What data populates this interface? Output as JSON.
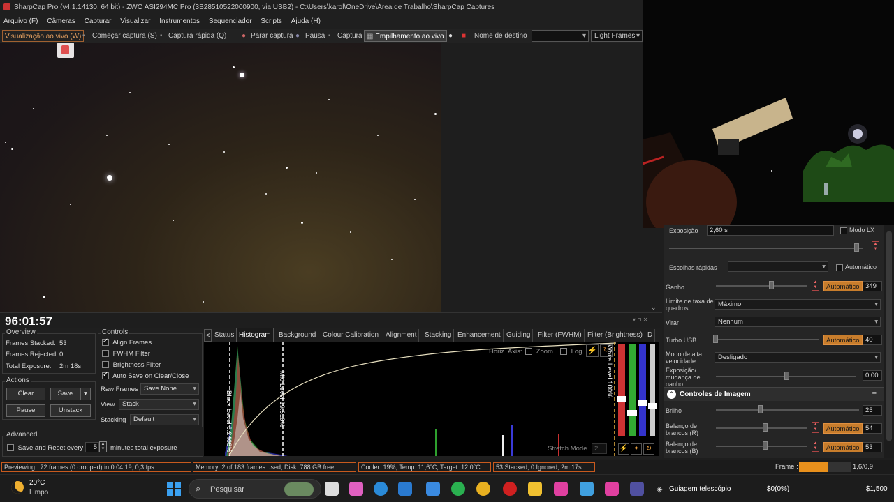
{
  "window": {
    "title": "SharpCap Pro (v4.1.14130, 64 bit) - ZWO ASI294MC Pro (3B28510522000900, via USB2) - C:\\Users\\karol\\OneDrive\\Área de Trabalho\\SharpCap Captures"
  },
  "menu": [
    "Arquivo (F)",
    "Câmeras",
    "Capturar",
    "Visualizar",
    "Instrumentos",
    "Sequenciador",
    "Scripts",
    "Ajuda (H)"
  ],
  "toolbar": {
    "live_view": "Visualização ao vivo (W)",
    "start_capture": "Começar captura (S)",
    "quick_capture": "Captura rápida (Q)",
    "stop_capture": "Parar captura",
    "pause": "Pausa",
    "capture": "Captura",
    "live_stack": "Empilhamento ao vivo",
    "target_label": "Nome de destino",
    "target_value": "",
    "frame_type": "Light Frames"
  },
  "camera_controls": {
    "exposure_label": "Exposição",
    "exposure_value": "2,60 s",
    "lx_mode": "Modo LX",
    "quick_picks_label": "Escolhas rápidas",
    "quick_picks_value": "",
    "auto": "Automático",
    "gain_label": "Ganho",
    "gain_auto": "Automático",
    "gain_value": "349",
    "frame_rate_label": "Limite de taxa de quadros",
    "frame_rate_value": "Máximo",
    "flip_label": "Virar",
    "flip_value": "Nenhum",
    "usb_label": "Turbo USB",
    "usb_auto": "Automático",
    "usb_value": "40",
    "hs_label": "Modo de alta velocidade",
    "hs_value": "Desligado",
    "exp_gain_label": "Exposição/ mudança de ganho",
    "exp_gain_value": "0.00",
    "image_controls_title": "Controles de Imagem",
    "brightness_label": "Brilho",
    "brightness_value": "25",
    "wb_r_label": "Balanço de brancos (R)",
    "wb_r_auto": "Automático",
    "wb_r_value": "54",
    "wb_b_label": "Balanço de brancos (B)",
    "wb_b_auto": "Automático",
    "wb_b_value": "53"
  },
  "stacking": {
    "timer": "96:01:57",
    "overview_title": "Overview",
    "frames_stacked_label": "Frames Stacked:",
    "frames_stacked": "53",
    "frames_rejected_label": "Frames Rejected:",
    "frames_rejected": "0",
    "total_exposure_label": "Total Exposure:",
    "total_exposure": "2m 18s",
    "actions_title": "Actions",
    "clear": "Clear",
    "save": "Save",
    "pause": "Pause",
    "unstack": "Unstack",
    "advanced_title": "Advanced",
    "save_reset_label": "Save and Reset every",
    "save_reset_value": "5",
    "minutes_label": "minutes total exposure",
    "controls_title": "Controls",
    "align_frames": "Align Frames",
    "fwhm_filter": "FWHM Filter",
    "brightness_filter": "Brightness Filter",
    "auto_save": "Auto Save on Clear/Close",
    "raw_frames_label": "Raw Frames",
    "raw_frames_value": "Save None",
    "view_label": "View",
    "view_value": "Stack",
    "stacking_label": "Stacking",
    "stacking_value": "Default"
  },
  "tabs": [
    "Status",
    "Histogram",
    "Background",
    "Colour Calibration",
    "Alignment",
    "Stacking",
    "Enhancement",
    "Guiding",
    "Filter (FWHM)",
    "Filter (Brightness)",
    "D"
  ],
  "histogram": {
    "horiz_axis": "Horiz. Axis:",
    "zoom": "Zoom",
    "log": "Log",
    "black_level": "Black Level 0.2466%",
    "mid_level": "Mid Level 19.618%",
    "white_level": "White Level 100%",
    "stretch_mode": "Stretch Mode",
    "stretch_value": "2"
  },
  "status": {
    "previewing": "Previewing : 72 frames (0 dropped) in 0:04:19, 0,3 fps",
    "memory": "Memory: 2 of 183 frames used, Disk: 788 GB free",
    "cooler": "Cooler: 19%, Temp: 11,6°C, Target: 12,0°C",
    "stacked": "53 Stacked, 0 Ignored, 2m 17s",
    "frame_label": "Frame :",
    "frame_ratio": "1,6/0,9",
    "frame_progress": 0.55
  },
  "taskbar": {
    "temperature": "20°C",
    "weather": "Limpo",
    "search": "Pesquisar",
    "app1": "Guiagem telescópio",
    "price_change": "$0(0%)",
    "price": "$1,500"
  }
}
